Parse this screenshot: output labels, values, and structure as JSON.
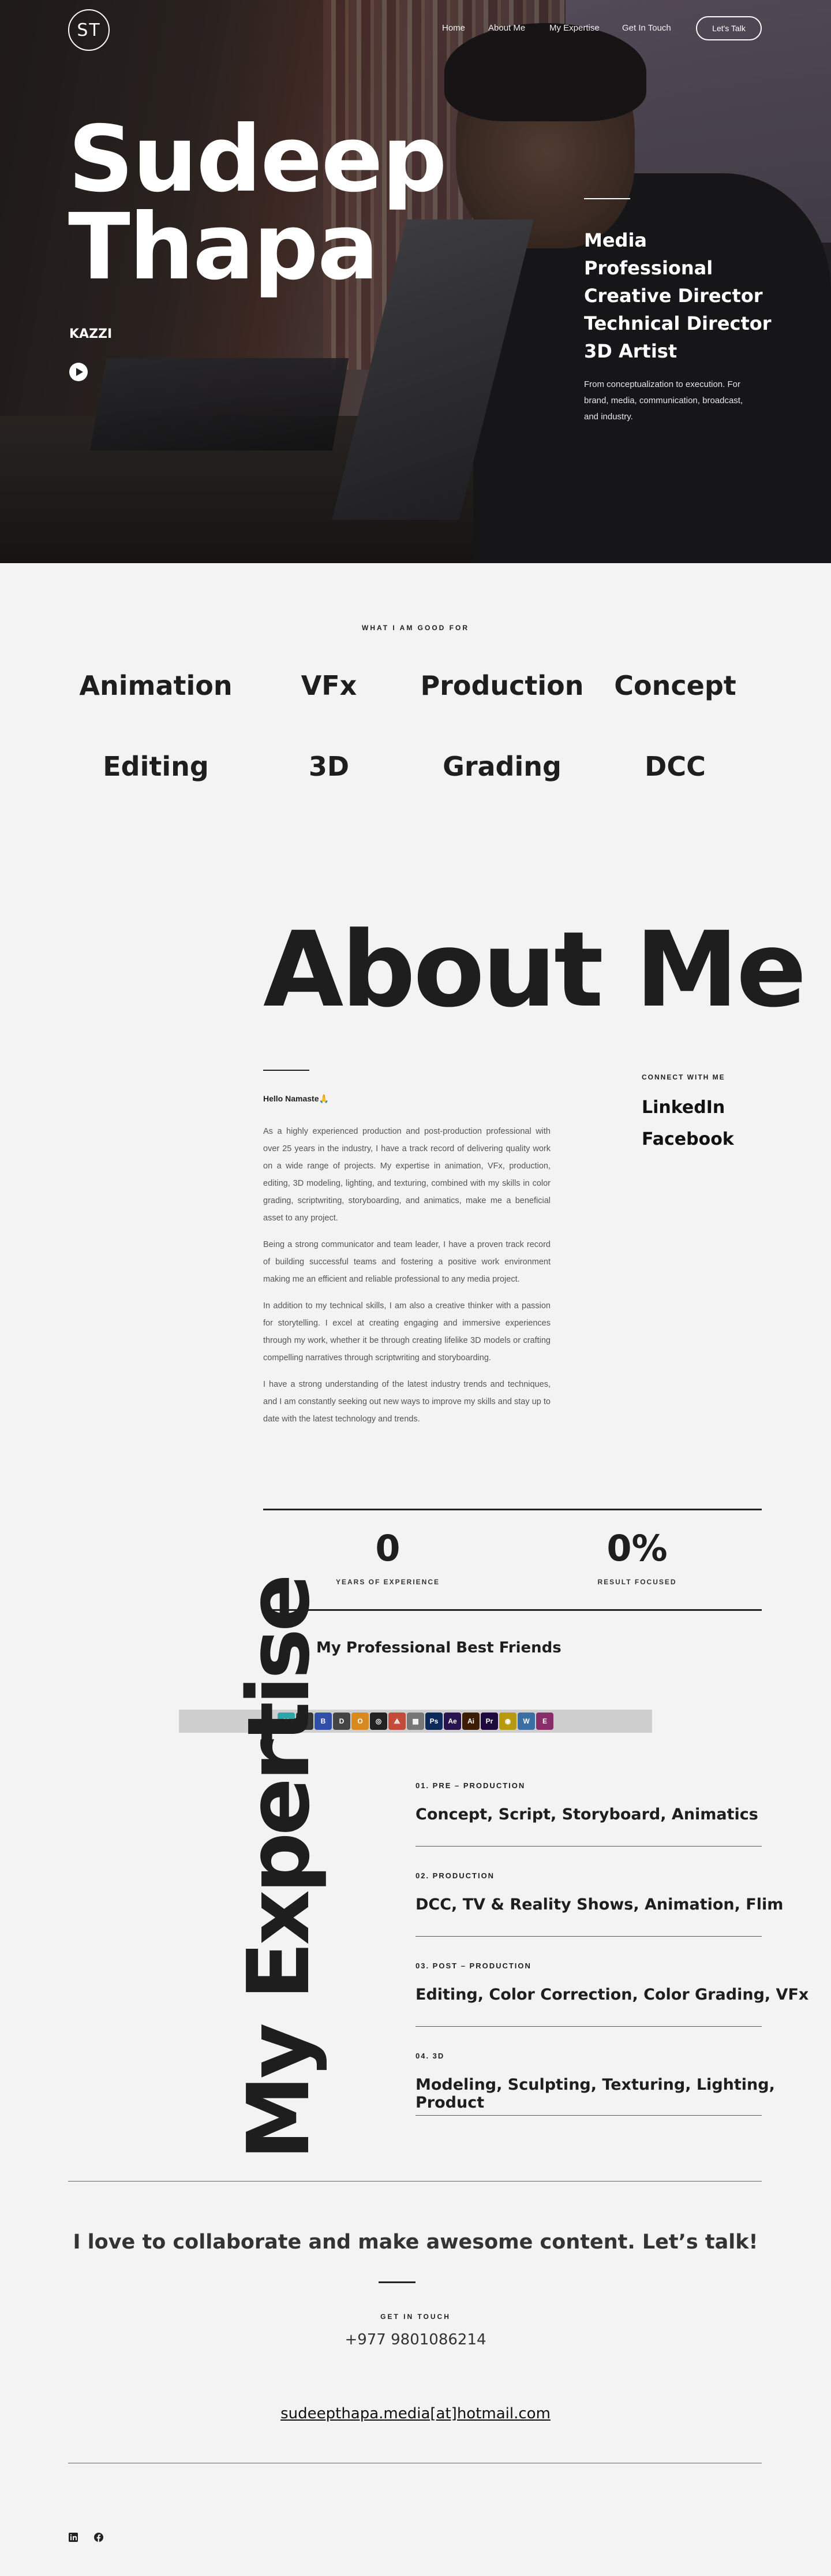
{
  "header": {
    "logo_text": "ST",
    "nav": [
      "Home",
      "About Me",
      "My Expertise",
      "Get In Touch"
    ],
    "cta": "Let's Talk"
  },
  "hero": {
    "name_line1": "Sudeep",
    "name_line2": "Thapa",
    "nickname": "KAZZI",
    "roles": [
      "Media",
      "Professional",
      "Creative Director",
      "Technical Director",
      "3D Artist"
    ],
    "tagline": "From conceptualization to execution. For brand, media, communication, broadcast, and industry."
  },
  "skills": {
    "eyebrow": "WHAT I AM GOOD FOR",
    "items": [
      "Animation",
      "VFx",
      "Production",
      "Concept",
      "Editing",
      "3D",
      "Grading",
      "DCC"
    ]
  },
  "about": {
    "title": "About Me",
    "hello": "Hello Namaste🙏",
    "paragraphs": [
      "As a highly experienced production and post-production professional with over 25 years in the industry, I have a track record of delivering quality work on a wide range of projects. My expertise in animation, VFx, production, editing, 3D modeling, lighting, and texturing, combined with my skills in color grading, scriptwriting, storyboarding, and animatics, make me a beneficial asset to any project.",
      "Being a strong communicator and team leader, I have a proven track record of building successful teams and fostering a positive work environment making me an efficient and reliable professional to any media project.",
      "In addition to my technical skills, I am also a creative thinker with a passion for storytelling. I excel at creating engaging and immersive experiences through my work, whether it be through creating lifelike 3D models or crafting compelling narratives through scriptwriting and storyboarding.",
      "I have a strong understanding of the latest industry trends and techniques, and I am constantly seeking out new ways to improve my skills and stay up to date with the latest technology and trends."
    ],
    "connect_eyebrow": "CONNECT WITH ME",
    "links": [
      "LinkedIn",
      "Facebook"
    ]
  },
  "stats": [
    {
      "value": "0",
      "label": "YEARS OF EXPERIENCE"
    },
    {
      "value": "0%",
      "label": "RESULT FOCUSED"
    }
  ],
  "friends": {
    "title": "My Professional Best Friends",
    "tools": [
      {
        "label": "M",
        "color": "#2aa6a6"
      },
      {
        "label": "Z",
        "color": "#333333"
      },
      {
        "label": "B",
        "color": "#2f4fa8"
      },
      {
        "label": "D",
        "color": "#444444"
      },
      {
        "label": "O",
        "color": "#d98a1f"
      },
      {
        "label": "◎",
        "color": "#222222"
      },
      {
        "label": "⟁",
        "color": "#c44b3a"
      },
      {
        "label": "▦",
        "color": "#777777"
      },
      {
        "label": "Ps",
        "color": "#0c2a5a"
      },
      {
        "label": "Ae",
        "color": "#2a1450"
      },
      {
        "label": "Ai",
        "color": "#3b1d05"
      },
      {
        "label": "Pr",
        "color": "#1f0a3f"
      },
      {
        "label": "◉",
        "color": "#b89a10"
      },
      {
        "label": "W",
        "color": "#3a6ea5"
      },
      {
        "label": "E",
        "color": "#8a2d6b"
      }
    ]
  },
  "expertise": {
    "title": "My Expertise",
    "items": [
      {
        "eyebrow": "01. PRE – PRODUCTION",
        "title": "Concept, Script, Storyboard, Animatics"
      },
      {
        "eyebrow": "02. PRODUCTION",
        "title": "DCC, TV & Reality Shows, Animation, Flim"
      },
      {
        "eyebrow": "03. POST – PRODUCTION",
        "title": "Editing, Color Correction, Color Grading, VFx"
      },
      {
        "eyebrow": "04. 3D",
        "title": "Modeling, Sculpting, Texturing, Lighting, Product"
      }
    ]
  },
  "contact": {
    "headline": "I love to collaborate and make awesome content. Let’s talk!",
    "eyebrow": "GET IN TOUCH",
    "phone": "+977 9801086214",
    "email": "sudeepthapa.media[at]hotmail.com"
  },
  "footer": {
    "icons": [
      "linkedin-icon",
      "facebook-icon"
    ]
  }
}
